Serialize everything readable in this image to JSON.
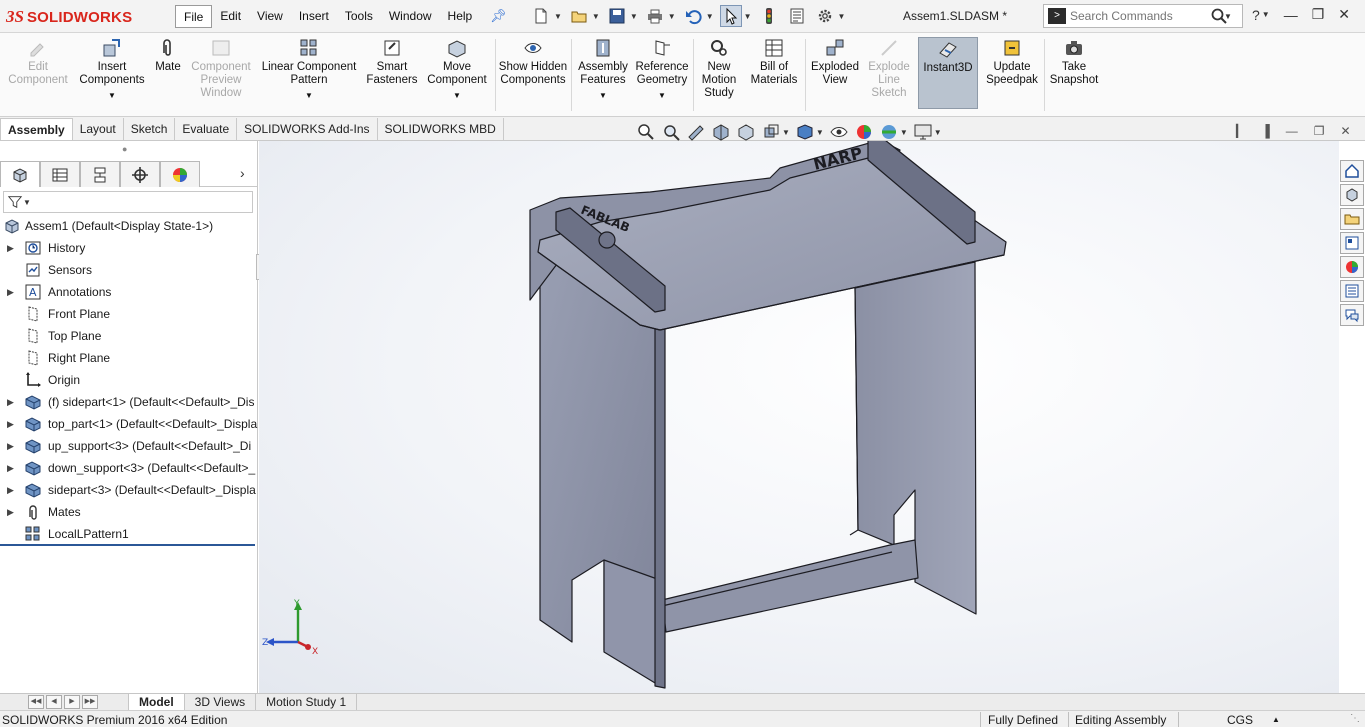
{
  "app": {
    "logo_ds": "3S",
    "logo_name": "SOLIDWORKS",
    "document_title": "Assem1.SLDASM *"
  },
  "menu": [
    "File",
    "Edit",
    "View",
    "Insert",
    "Tools",
    "Window",
    "Help"
  ],
  "search": {
    "placeholder": "Search Commands"
  },
  "ribbon": [
    {
      "label": "Edit Component",
      "disabled": true
    },
    {
      "label": "Insert Components",
      "disabled": false
    },
    {
      "label": "Mate",
      "disabled": false
    },
    {
      "label": "Component Preview Window",
      "disabled": true
    },
    {
      "label": "Linear Component Pattern",
      "disabled": false
    },
    {
      "label": "Smart Fasteners",
      "disabled": false
    },
    {
      "label": "Move Component",
      "disabled": false
    },
    {
      "label": "Show Hidden Components",
      "disabled": false
    },
    {
      "label": "Assembly Features",
      "disabled": false
    },
    {
      "label": "Reference Geometry",
      "disabled": false
    },
    {
      "label": "New Motion Study",
      "disabled": false
    },
    {
      "label": "Bill of Materials",
      "disabled": false
    },
    {
      "label": "Exploded View",
      "disabled": false
    },
    {
      "label": "Explode Line Sketch",
      "disabled": true
    },
    {
      "label": "Instant3D",
      "disabled": false
    },
    {
      "label": "Update Speedpak",
      "disabled": false
    },
    {
      "label": "Take Snapshot",
      "disabled": false
    }
  ],
  "cm_tabs": [
    "Assembly",
    "Layout",
    "Sketch",
    "Evaluate",
    "SOLIDWORKS Add-Ins",
    "SOLIDWORKS MBD"
  ],
  "tree": {
    "root": "Assem1  (Default<Display State-1>)",
    "items": [
      {
        "label": "History",
        "icon": "history-icon",
        "expandable": true
      },
      {
        "label": "Sensors",
        "icon": "sensors-icon",
        "expandable": false
      },
      {
        "label": "Annotations",
        "icon": "annotations-icon",
        "expandable": true
      },
      {
        "label": "Front Plane",
        "icon": "plane-icon",
        "expandable": false
      },
      {
        "label": "Top Plane",
        "icon": "plane-icon",
        "expandable": false
      },
      {
        "label": "Right Plane",
        "icon": "plane-icon",
        "expandable": false
      },
      {
        "label": "Origin",
        "icon": "origin-icon",
        "expandable": false
      },
      {
        "label": "(f) sidepart<1> (Default<<Default>_Dis",
        "icon": "part-icon",
        "expandable": true
      },
      {
        "label": "top_part<1> (Default<<Default>_Displa",
        "icon": "part-icon",
        "expandable": true
      },
      {
        "label": "up_support<3> (Default<<Default>_Di",
        "icon": "part-icon",
        "expandable": true
      },
      {
        "label": "down_support<3> (Default<<Default>_",
        "icon": "part-icon",
        "expandable": true
      },
      {
        "label": "sidepart<3> (Default<<Default>_Displa",
        "icon": "part-icon",
        "expandable": true
      },
      {
        "label": "Mates",
        "icon": "mates-icon",
        "expandable": true
      },
      {
        "label": "LocalLPattern1",
        "icon": "pattern-icon",
        "expandable": false
      }
    ]
  },
  "model_text": {
    "engraving_1": "FABLAB",
    "engraving_2": "NARP"
  },
  "triad": {
    "x": "X",
    "y": "Y",
    "z": "Z"
  },
  "bottom_tabs": [
    "Model",
    "3D Views",
    "Motion Study 1"
  ],
  "status": {
    "edition": "SOLIDWORKS Premium 2016 x64 Edition",
    "defined": "Fully Defined",
    "mode": "Editing Assembly",
    "units": "CGS"
  },
  "colors": {
    "brand": "#d9261c",
    "model_face": "#8a8fa3",
    "model_edge": "#1c1c22",
    "selection": "#2b5797"
  }
}
